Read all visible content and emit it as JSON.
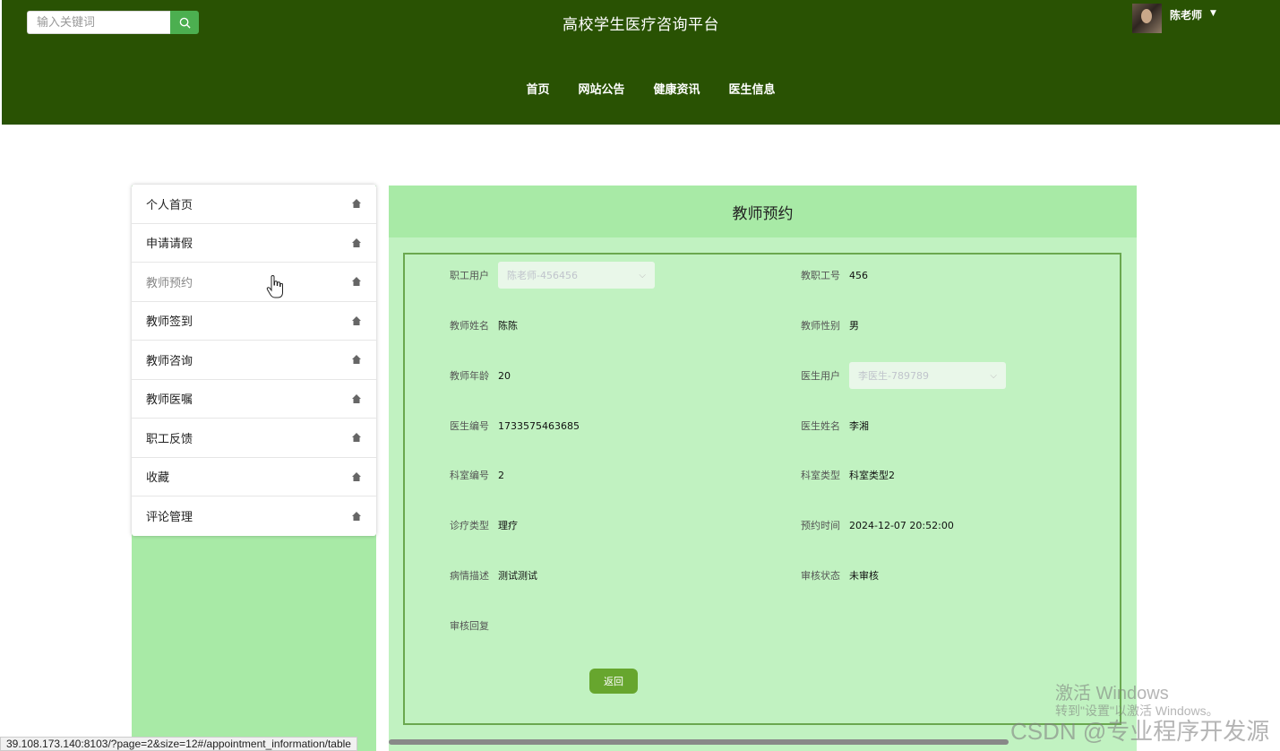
{
  "header": {
    "search_placeholder": "输入关键词",
    "site_title": "高校学生医疗咨询平台",
    "user_name": "陈老师",
    "nav": [
      "首页",
      "网站公告",
      "健康资讯",
      "医生信息"
    ]
  },
  "sidebar": {
    "items": [
      {
        "label": "个人首页"
      },
      {
        "label": "申请请假"
      },
      {
        "label": "教师预约",
        "active": true
      },
      {
        "label": "教师签到"
      },
      {
        "label": "教师咨询"
      },
      {
        "label": "教师医嘱"
      },
      {
        "label": "职工反馈"
      },
      {
        "label": "收藏"
      },
      {
        "label": "评论管理"
      }
    ]
  },
  "main": {
    "title": "教师预约",
    "fields": {
      "staff_user": {
        "label": "职工用户",
        "value": "陈老师-456456"
      },
      "staff_no": {
        "label": "教职工号",
        "value": "456"
      },
      "teacher_name": {
        "label": "教师姓名",
        "value": "陈陈"
      },
      "teacher_gender": {
        "label": "教师性别",
        "value": "男"
      },
      "teacher_age": {
        "label": "教师年龄",
        "value": "20"
      },
      "doctor_user": {
        "label": "医生用户",
        "value": "李医生-789789"
      },
      "doctor_no": {
        "label": "医生编号",
        "value": "1733575463685"
      },
      "doctor_name": {
        "label": "医生姓名",
        "value": "李湘"
      },
      "dept_no": {
        "label": "科室编号",
        "value": "2"
      },
      "dept_type": {
        "label": "科室类型",
        "value": "科室类型2"
      },
      "treat_type": {
        "label": "诊疗类型",
        "value": "理疗"
      },
      "appoint_time": {
        "label": "预约时间",
        "value": "2024-12-07 20:52:00"
      },
      "condition": {
        "label": "病情描述",
        "value": "测试测试"
      },
      "review_status": {
        "label": "审核状态",
        "value": "未审核"
      },
      "review_reply": {
        "label": "审核回复",
        "value": ""
      }
    },
    "back_label": "返回"
  },
  "browser": {
    "status_url": "39.108.173.140:8103/?page=2&size=12#/appointment_information/table"
  },
  "watermark": {
    "line1": "激活 Windows",
    "line2": "转到\"设置\"以激活 Windows。",
    "csdn": "CSDN @专业程序开发源"
  },
  "colors": {
    "header_bg": "#295203",
    "panel_light": "#c1f2c1",
    "panel_header": "#a8eaa6",
    "button": "#67a62e",
    "search_button": "#4caf50"
  }
}
